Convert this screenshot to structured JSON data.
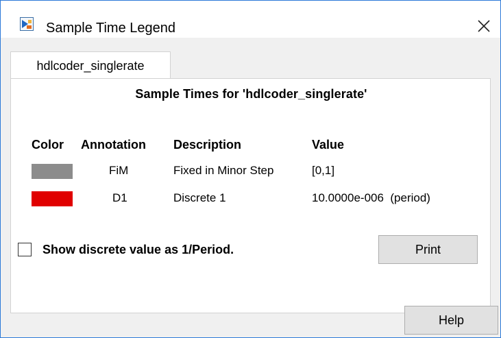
{
  "window": {
    "title": "Sample Time Legend"
  },
  "tab": {
    "label": "hdlcoder_singlerate"
  },
  "panel": {
    "heading": "Sample Times for 'hdlcoder_singlerate'",
    "columns": {
      "color": "Color",
      "annotation": "Annotation",
      "description": "Description",
      "value": "Value"
    },
    "rows": [
      {
        "color": "#8c8c8c",
        "annotation": "FiM",
        "description": "Fixed in Minor Step",
        "value": "[0,1]"
      },
      {
        "color": "#e00000",
        "annotation": "D1",
        "description": "Discrete 1",
        "value": "10.0000e-006  (period)"
      }
    ],
    "checkbox_label": "Show discrete value as 1/Period.",
    "checkbox_checked": false,
    "print_label": "Print"
  },
  "footer": {
    "help_label": "Help"
  },
  "icons": {
    "app": "simulink-icon",
    "close": "close-icon"
  }
}
